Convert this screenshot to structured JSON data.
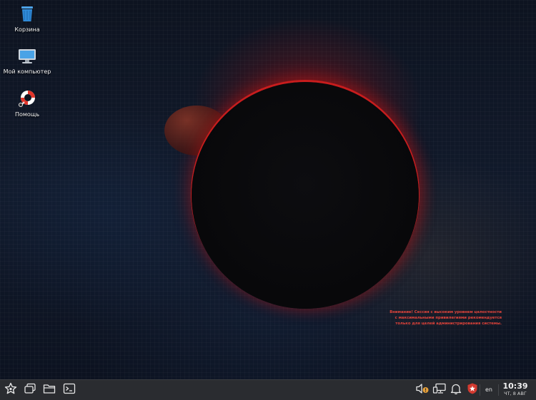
{
  "desktop": {
    "icons": [
      {
        "label": "Корзина",
        "icon": "trash-bin-icon"
      },
      {
        "label": "Мой компьютер",
        "icon": "computer-monitor-icon"
      },
      {
        "label": "Помощь",
        "icon": "lifebuoy-help-icon"
      }
    ],
    "warning_lines": [
      "Внимание! Сессия с высоким уровнем целостности",
      "с максимальными привилегиями рекомендуется",
      "только для целей администрирования системы."
    ]
  },
  "taskbar": {
    "left_buttons": [
      {
        "icon": "star-menu-icon"
      },
      {
        "icon": "windows-overview-icon"
      },
      {
        "icon": "file-manager-icon"
      },
      {
        "icon": "terminal-icon"
      }
    ],
    "tray": [
      {
        "icon": "volume-muted-icon"
      },
      {
        "icon": "network-wired-icon"
      },
      {
        "icon": "notifications-bell-icon"
      },
      {
        "icon": "security-shield-icon"
      }
    ],
    "language": "en",
    "time": "10:39",
    "date": "ЧТ, 8 АВГ"
  },
  "colors": {
    "taskbar_bg": "#2a2c30",
    "warning_text": "#e2443b",
    "eclipse_glow": "#d21e1e"
  }
}
